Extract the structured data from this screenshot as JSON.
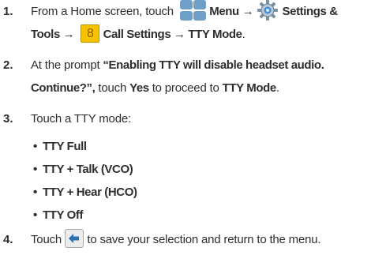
{
  "steps": [
    {
      "number": "1.",
      "menu_label": "Menu →",
      "settings_label": "Settings &",
      "line2_prefix": "Tools →",
      "call_settings_number": "8",
      "call_settings_label": "Call Settings → TTY Mode",
      "end": "."
    },
    {
      "number": "2.",
      "line1_prefix": "At the prompt ",
      "prompt_text_a": "“Enabling TTY will disable headset audio.",
      "prompt_text_b": "Continue?”,",
      "line2_mid": " touch ",
      "yes_label": "Yes",
      "line2_mid2": " to proceed to ",
      "tty_mode_label": "TTY Mode",
      "end": "."
    },
    {
      "number": "3.",
      "text": "Touch a TTY mode:"
    },
    {
      "number": "4.",
      "prefix": "Touch",
      "suffix": "to save your selection and return to the menu."
    }
  ],
  "step1_intro": "From a Home screen, touch",
  "bullet_char": "•",
  "tty_modes": [
    "TTY Full",
    "TTY + Talk (VCO)",
    "TTY + Hear (HCO)",
    "TTY Off"
  ],
  "colors": {
    "text": "#2e2e2e",
    "menu_icon": "#6f9fc7",
    "number_icon": "#f4c400"
  }
}
